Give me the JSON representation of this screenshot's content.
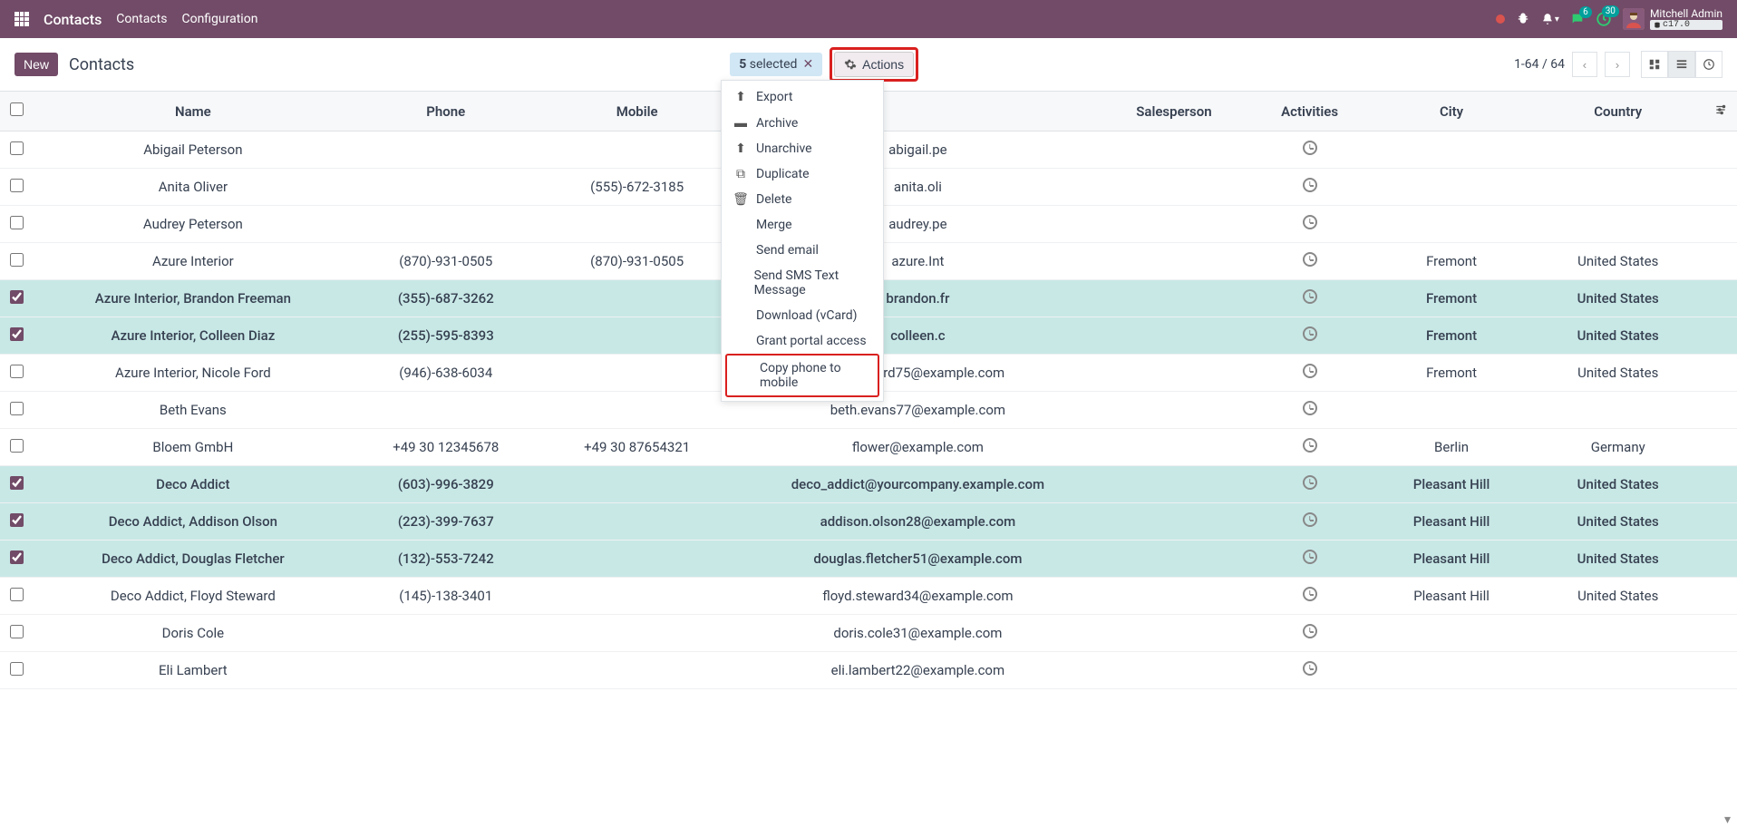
{
  "navbar": {
    "brand": "Contacts",
    "menu": [
      "Contacts",
      "Configuration"
    ],
    "msg_badge": "6",
    "activity_badge": "30",
    "user_name": "Mitchell Admin",
    "db": "c17.0"
  },
  "control": {
    "new_label": "New",
    "breadcrumb": "Contacts",
    "selected_count": "5",
    "selected_suffix": "selected",
    "actions_label": "Actions",
    "pager": "1-64 / 64"
  },
  "columns": {
    "name": "Name",
    "phone": "Phone",
    "mobile": "Mobile",
    "salesperson": "Salesperson",
    "activities": "Activities",
    "city": "City",
    "country": "Country"
  },
  "dropdown": {
    "export": "Export",
    "archive": "Archive",
    "unarchive": "Unarchive",
    "duplicate": "Duplicate",
    "delete": "Delete",
    "merge": "Merge",
    "send_email": "Send email",
    "send_sms": "Send SMS Text Message",
    "download_vcard": "Download (vCard)",
    "grant_portal": "Grant portal access",
    "copy_phone": "Copy phone to mobile"
  },
  "rows": [
    {
      "sel": false,
      "name": "Abigail Peterson",
      "phone": "",
      "mobile": "",
      "email": "abigail.pe",
      "city": "",
      "country": ""
    },
    {
      "sel": false,
      "name": "Anita Oliver",
      "phone": "",
      "mobile": "(555)-672-3185",
      "email": "anita.oli",
      "city": "",
      "country": ""
    },
    {
      "sel": false,
      "name": "Audrey Peterson",
      "phone": "",
      "mobile": "",
      "email": "audrey.pe",
      "city": "",
      "country": ""
    },
    {
      "sel": false,
      "name": "Azure Interior",
      "phone": "(870)-931-0505",
      "mobile": "(870)-931-0505",
      "email": "azure.Int",
      "city": "Fremont",
      "country": "United States"
    },
    {
      "sel": true,
      "name": "Azure Interior, Brandon Freeman",
      "phone": "(355)-687-3262",
      "mobile": "",
      "email": "brandon.fr",
      "city": "Fremont",
      "country": "United States"
    },
    {
      "sel": true,
      "name": "Azure Interior, Colleen Diaz",
      "phone": "(255)-595-8393",
      "mobile": "",
      "email": "colleen.c",
      "city": "Fremont",
      "country": "United States"
    },
    {
      "sel": false,
      "name": "Azure Interior, Nicole Ford",
      "phone": "(946)-638-6034",
      "mobile": "",
      "email": "nicole.ford75@example.com",
      "city": "Fremont",
      "country": "United States"
    },
    {
      "sel": false,
      "name": "Beth Evans",
      "phone": "",
      "mobile": "",
      "email": "beth.evans77@example.com",
      "city": "",
      "country": ""
    },
    {
      "sel": false,
      "name": "Bloem GmbH",
      "phone": "+49 30 12345678",
      "mobile": "+49 30 87654321",
      "email": "flower@example.com",
      "city": "Berlin",
      "country": "Germany"
    },
    {
      "sel": true,
      "name": "Deco Addict",
      "phone": "(603)-996-3829",
      "mobile": "",
      "email": "deco_addict@yourcompany.example.com",
      "city": "Pleasant Hill",
      "country": "United States"
    },
    {
      "sel": true,
      "name": "Deco Addict, Addison Olson",
      "phone": "(223)-399-7637",
      "mobile": "",
      "email": "addison.olson28@example.com",
      "city": "Pleasant Hill",
      "country": "United States"
    },
    {
      "sel": true,
      "name": "Deco Addict, Douglas Fletcher",
      "phone": "(132)-553-7242",
      "mobile": "",
      "email": "douglas.fletcher51@example.com",
      "city": "Pleasant Hill",
      "country": "United States"
    },
    {
      "sel": false,
      "name": "Deco Addict, Floyd Steward",
      "phone": "(145)-138-3401",
      "mobile": "",
      "email": "floyd.steward34@example.com",
      "city": "Pleasant Hill",
      "country": "United States"
    },
    {
      "sel": false,
      "name": "Doris Cole",
      "phone": "",
      "mobile": "",
      "email": "doris.cole31@example.com",
      "city": "",
      "country": ""
    },
    {
      "sel": false,
      "name": "Eli Lambert",
      "phone": "",
      "mobile": "",
      "email": "eli.lambert22@example.com",
      "city": "",
      "country": ""
    }
  ]
}
